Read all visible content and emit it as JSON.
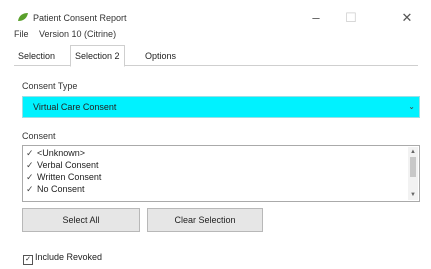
{
  "window": {
    "title": "Patient Consent Report",
    "minimize": "–",
    "maximize": "☐",
    "close": "✕"
  },
  "menu": {
    "file": "File",
    "version": "Version 10 (Citrine)"
  },
  "tabs": [
    "Selection",
    "Selection 2",
    "Options"
  ],
  "consent_type": {
    "label": "Consent Type",
    "selected": "Virtual Care Consent"
  },
  "consent": {
    "label": "Consent",
    "items": [
      {
        "label": "<Unknown>",
        "checked": true
      },
      {
        "label": "Verbal Consent",
        "checked": true
      },
      {
        "label": "Written Consent",
        "checked": true
      },
      {
        "label": "No Consent",
        "checked": true
      }
    ]
  },
  "buttons": {
    "select_all": "Select All",
    "clear_selection": "Clear Selection"
  },
  "include_revoked": {
    "label": "Include Revoked",
    "checked": true
  },
  "colors": {
    "dropdown_highlight": "#00f2ff",
    "app_icon": "#5aa02c"
  }
}
